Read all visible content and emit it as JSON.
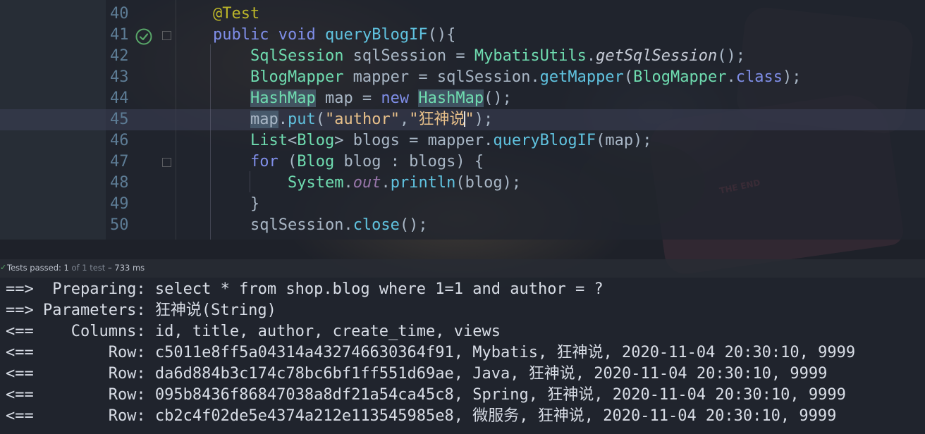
{
  "editor": {
    "lines": [
      {
        "num": "40",
        "tokens": [
          {
            "t": "@Test",
            "c": "t-ann"
          }
        ]
      },
      {
        "num": "41",
        "tokens": [
          {
            "t": "public",
            "c": "t-kw"
          },
          {
            "t": " "
          },
          {
            "t": "void",
            "c": "t-kw"
          },
          {
            "t": " "
          },
          {
            "t": "queryBlogIF",
            "c": "t-fn"
          },
          {
            "t": "(){"
          }
        ]
      },
      {
        "num": "42",
        "tokens": [
          {
            "t": "    "
          },
          {
            "t": "SqlSession",
            "c": "t-type"
          },
          {
            "t": " sqlSession = "
          },
          {
            "t": "MybatisUtils",
            "c": "t-type"
          },
          {
            "t": "."
          },
          {
            "t": "getSqlSession",
            "c": "t-it"
          },
          {
            "t": "();"
          }
        ]
      },
      {
        "num": "43",
        "tokens": [
          {
            "t": "    "
          },
          {
            "t": "BlogMapper",
            "c": "t-type"
          },
          {
            "t": " mapper = sqlSession."
          },
          {
            "t": "getMapper",
            "c": "t-fn"
          },
          {
            "t": "("
          },
          {
            "t": "BlogMapper",
            "c": "t-type"
          },
          {
            "t": "."
          },
          {
            "t": "class",
            "c": "t-kw"
          },
          {
            "t": ");"
          }
        ]
      },
      {
        "num": "44",
        "tokens": [
          {
            "t": "    "
          },
          {
            "t": "HashMap",
            "c": "t-type t-hl"
          },
          {
            "t": " map = "
          },
          {
            "t": "new",
            "c": "t-kw"
          },
          {
            "t": " "
          },
          {
            "t": "HashMap",
            "c": "t-type t-hl"
          },
          {
            "t": "();"
          }
        ]
      },
      {
        "num": "45",
        "current": true,
        "tokens": [
          {
            "t": "    "
          },
          {
            "t": "map",
            "c": "t-hl"
          },
          {
            "t": "."
          },
          {
            "t": "put",
            "c": "t-fn"
          },
          {
            "t": "("
          },
          {
            "t": "\"author\"",
            "c": "t-str"
          },
          {
            "t": ","
          },
          {
            "t": "\"狂神说",
            "c": "t-str"
          },
          {
            "caret": true
          },
          {
            "t": "\"",
            "c": "t-str"
          },
          {
            "t": ");"
          }
        ]
      },
      {
        "num": "46",
        "tokens": [
          {
            "t": "    "
          },
          {
            "t": "List",
            "c": "t-type"
          },
          {
            "t": "<"
          },
          {
            "t": "Blog",
            "c": "t-type"
          },
          {
            "t": "> blogs = mapper."
          },
          {
            "t": "queryBlogIF",
            "c": "t-fn"
          },
          {
            "t": "(map);"
          }
        ]
      },
      {
        "num": "47",
        "tokens": [
          {
            "t": "    "
          },
          {
            "t": "for",
            "c": "t-kw"
          },
          {
            "t": " ("
          },
          {
            "t": "Blog",
            "c": "t-type"
          },
          {
            "t": " blog : blogs) {"
          }
        ]
      },
      {
        "num": "48",
        "tokens": [
          {
            "t": "        "
          },
          {
            "t": "System",
            "c": "t-type"
          },
          {
            "t": "."
          },
          {
            "t": "out",
            "c": "t-static"
          },
          {
            "t": "."
          },
          {
            "t": "println",
            "c": "t-fn"
          },
          {
            "t": "(blog);"
          }
        ]
      },
      {
        "num": "49",
        "tokens": [
          {
            "t": "    }"
          }
        ]
      },
      {
        "num": "50",
        "tokens": [
          {
            "t": "    sqlSession."
          },
          {
            "t": "close",
            "c": "t-fn"
          },
          {
            "t": "();"
          }
        ]
      }
    ]
  },
  "test_status": {
    "label": "Tests passed:",
    "passed": "1",
    "of_text": "of 1 test",
    "duration": "– 733 ms"
  },
  "console": {
    "lines": [
      "==>  Preparing: select * from shop.blog where 1=1 and author = ?",
      "==> Parameters: 狂神说(String)",
      "<==    Columns: id, title, author, create_time, views",
      "<==        Row: c5011e8ff5a04314a432746630364f91, Mybatis, 狂神说, 2020-11-04 20:30:10, 9999",
      "<==        Row: da6d884b3c174c78bc6bf1ff551d69ae, Java, 狂神说, 2020-11-04 20:30:10, 9999",
      "<==        Row: 095b8436f86847038a8df21a54ca45c8, Spring, 狂神说, 2020-11-04 20:30:10, 9999",
      "<==        Row: cb2c4f02de5e4374a212e113545985e8, 微服务, 狂神说, 2020-11-04 20:30:10, 9999"
    ]
  },
  "colors": {
    "keyword": "#7f8ee8",
    "type": "#6fdcb0",
    "string": "#e8c08a",
    "annotation": "#bbb529",
    "test_pass": "#59a869"
  },
  "icons": {
    "run_test": "test-passed-run-icon",
    "status": "check-icon"
  }
}
